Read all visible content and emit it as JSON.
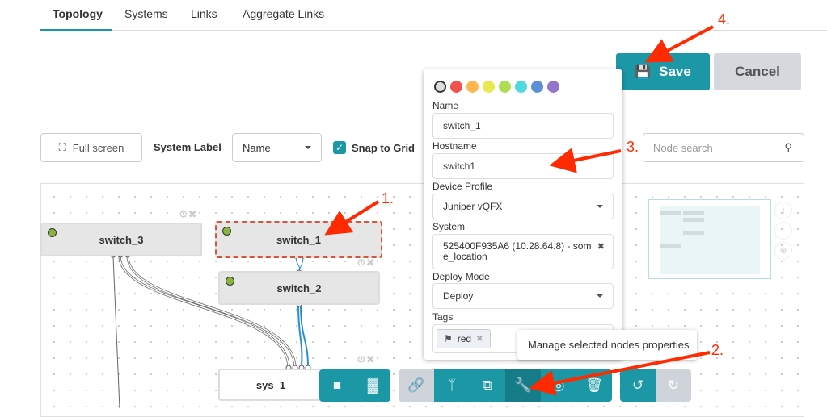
{
  "tabs": [
    {
      "label": "Topology",
      "active": true
    },
    {
      "label": "Systems"
    },
    {
      "label": "Links"
    },
    {
      "label": "Aggregate Links"
    }
  ],
  "actions": {
    "save_label": "Save",
    "save_icon": "floppy-disk-icon",
    "cancel_label": "Cancel"
  },
  "toolbar": {
    "full_screen_label": "Full screen",
    "system_label_label": "System Label",
    "system_label_value": "Name",
    "snap_label": "Snap to Grid",
    "snap_checked": true,
    "node_search_placeholder": "Node search"
  },
  "nodes": [
    {
      "label": "switch_3"
    },
    {
      "label": "switch_1",
      "selected": true
    },
    {
      "label": "switch_2"
    },
    {
      "label": "sys_1"
    }
  ],
  "popup": {
    "colors": [
      "#dddddd",
      "#ef5350",
      "#ffb74d",
      "#e8e84f",
      "#b0dc52",
      "#4dd9e0",
      "#5b8fd6",
      "#9575cd"
    ],
    "name_label": "Name",
    "name_value": "switch_1",
    "hostname_label": "Hostname",
    "hostname_value": "switch1",
    "device_profile_label": "Device Profile",
    "device_profile_value": "Juniper vQFX",
    "system_label": "System",
    "system_value": "525400F935A6 (10.28.64.8) - some_location",
    "deploy_mode_label": "Deploy Mode",
    "deploy_mode_value": "Deploy",
    "tags_label": "Tags",
    "tags": [
      "red"
    ]
  },
  "tooltip": "Manage selected nodes properties",
  "annotations": [
    "1.",
    "2.",
    "3.",
    "4."
  ],
  "colors": {
    "accent": "#1b97a5",
    "annotation": "#ff2a00"
  }
}
